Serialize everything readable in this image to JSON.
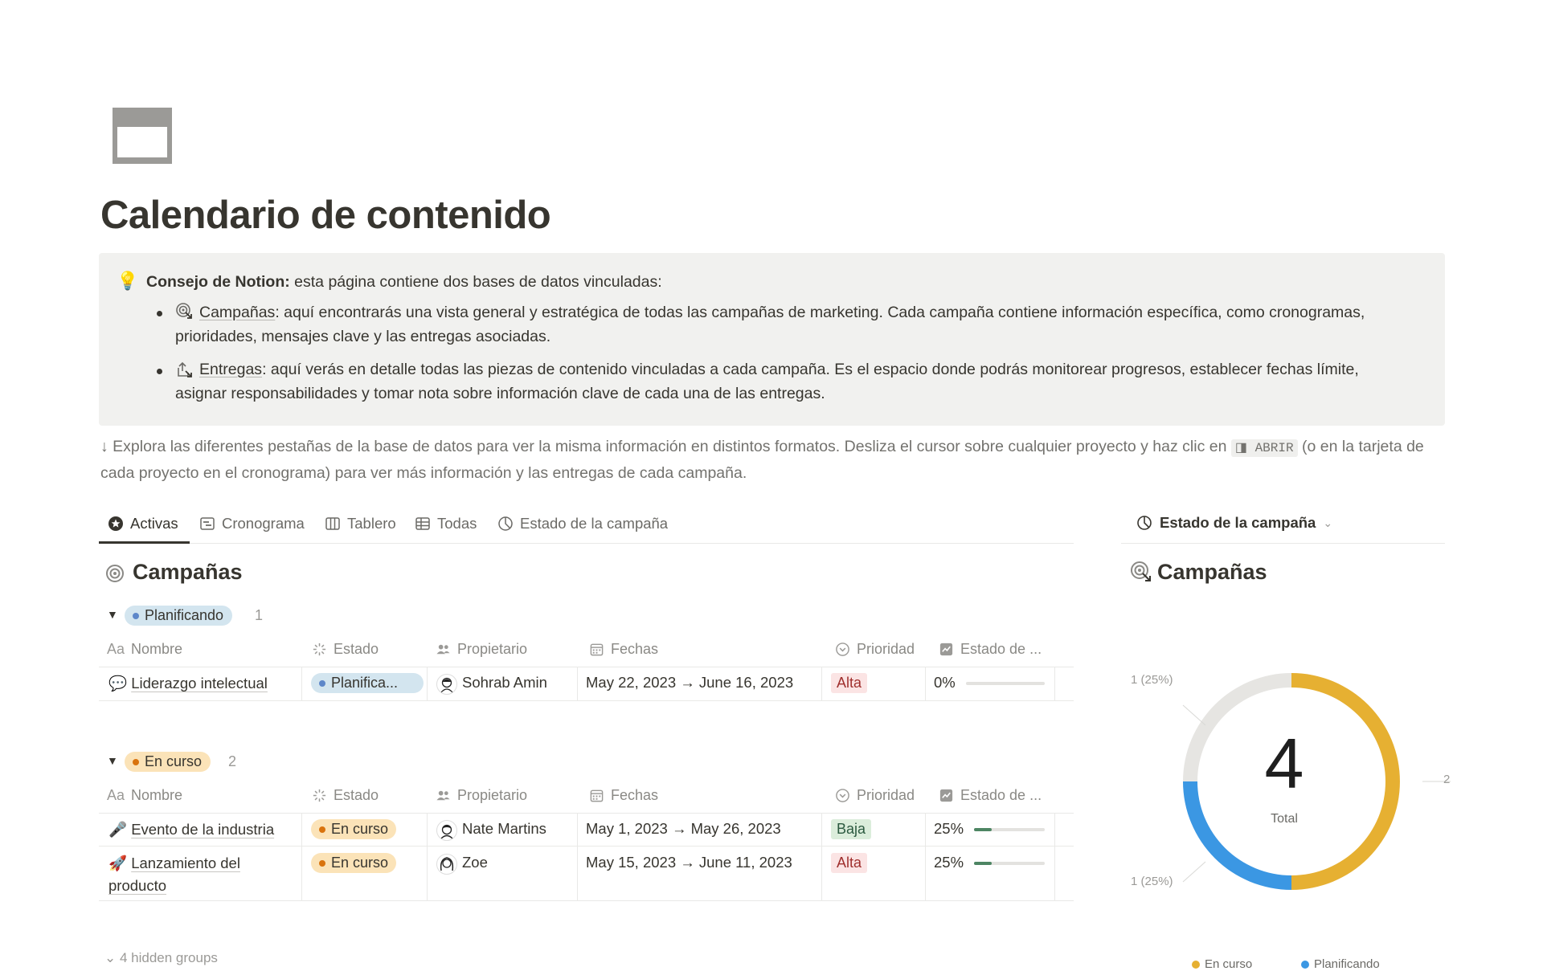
{
  "page": {
    "title": "Calendario de contenido",
    "icon": "calendar-icon"
  },
  "callout": {
    "icon": "💡",
    "lead_bold": "Consejo de Notion:",
    "lead_rest": " esta página contiene dos bases de datos vinculadas:",
    "items": [
      {
        "icon": "target-arrow-icon",
        "name": "Campañas",
        "text": ": aquí encontrarás una vista general y estratégica de todas las campañas de marketing. Cada campaña contiene información específica, como cronogramas, prioridades, mensajes clave y las entregas asociadas."
      },
      {
        "icon": "share-arrow-icon",
        "name": "Entregas",
        "text": ": aquí verás en detalle todas las piezas de contenido vinculadas a cada campaña. Es el espacio donde podrás monitorear progresos, establecer fechas límite, asignar responsabilidades y tomar nota sobre información clave de cada una de las entregas."
      }
    ]
  },
  "hint": {
    "part1": "↓ Explora las diferentes pestañas de la base de datos para ver la misma información en distintos formatos. Desliza el cursor sobre cualquier proyecto y haz clic en ",
    "code": "◨ ABRIR",
    "part2": " (o en la tarjeta de cada proyecto en el cronograma) para ver más información y las entregas de cada campaña."
  },
  "tabs": [
    {
      "label": "Activas",
      "icon": "star-icon",
      "active": true
    },
    {
      "label": "Cronograma",
      "icon": "timeline-icon",
      "active": false
    },
    {
      "label": "Tablero",
      "icon": "board-icon",
      "active": false
    },
    {
      "label": "Todas",
      "icon": "table-icon",
      "active": false
    },
    {
      "label": "Estado de la campaña",
      "icon": "chart-pie-icon",
      "active": false
    }
  ],
  "database": {
    "title": "Campañas",
    "columns": [
      "Nombre",
      "Estado",
      "Propietario",
      "Fechas",
      "Prioridad",
      "Estado de ..."
    ],
    "column_header_prefix": "Aa",
    "groups": [
      {
        "label": "Planificando",
        "count": "1",
        "color": "#d3e5ef",
        "dot": "#5e87c9",
        "rows": [
          {
            "emoji": "💬",
            "name": "Liderazgo intelectual",
            "status": "Planifica...",
            "owner": "Sohrab Amin",
            "dates": "May 22, 2023 → June 16, 2023",
            "priority": "Alta",
            "progress_label": "0%",
            "progress": 0
          }
        ]
      },
      {
        "label": "En curso",
        "count": "2",
        "color": "#fbe3b8",
        "dot": "#d9730d",
        "rows": [
          {
            "emoji": "🎤",
            "name": "Evento de la industria",
            "status": "En curso",
            "owner": "Nate Martins",
            "dates": "May 1, 2023 → May 26, 2023",
            "priority": "Baja",
            "progress_label": "25%",
            "progress": 0.25
          },
          {
            "emoji": "🚀",
            "name": "Lanzamiento del producto",
            "status": "En curso",
            "owner": "Zoe",
            "dates": "May 15, 2023 → June 11, 2023",
            "priority": "Alta",
            "progress_label": "25%",
            "progress": 0.25
          }
        ]
      }
    ],
    "hidden_groups": "4 hidden groups"
  },
  "priority_colors": {
    "Alta": {
      "bg": "#fbe4e4",
      "fg": "#9f2f2d"
    },
    "Baja": {
      "bg": "#dbeddb",
      "fg": "#2b593f"
    }
  },
  "right_panel": {
    "view_label": "Estado de la campaña",
    "title": "Campañas",
    "chart_data": {
      "type": "pie",
      "center_value": "4",
      "center_label": "Total",
      "slices": [
        {
          "label": "En curso",
          "value": 2,
          "color": "#e6b032"
        },
        {
          "label": "Planificando",
          "value": 1,
          "color": "#3b97e3"
        },
        {
          "label": "",
          "value": 1,
          "color": "#e6e5e2"
        }
      ],
      "slice_annotations": [
        "1 (25%)",
        "1 (25%)",
        "2"
      ],
      "legend": [
        "En curso",
        "Planificando"
      ]
    }
  }
}
